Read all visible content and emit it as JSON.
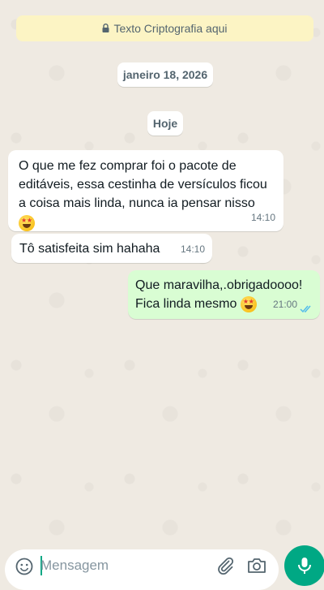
{
  "encryption_banner": {
    "icon": "lock-icon",
    "text": "Texto Criptografia aqui"
  },
  "date_separator": "janeiro 18, 2026",
  "today_separator": "Hoje",
  "messages": [
    {
      "direction": "incoming",
      "text": "O que me fez comprar foi o pacote de editáveis, essa cestinha de versículos ficou a coisa mais linda, nunca ia pensar nisso",
      "emoji": "star-struck-emoji",
      "time": "14:10"
    },
    {
      "direction": "incoming",
      "text": "Tô satisfeita sim hahaha",
      "time": "14:10"
    },
    {
      "direction": "outgoing",
      "line1": "Que maravilha,.obrigadoooo!",
      "line2": "Fica linda mesmo",
      "emoji": "star-struck-emoji",
      "time": "21:00",
      "status": "read"
    }
  ],
  "composer": {
    "placeholder": "Mensagem",
    "icons": [
      "emoji-icon",
      "paperclip-icon",
      "camera-icon",
      "microphone-icon"
    ]
  },
  "colors": {
    "wallpaper": "#efeae2",
    "outgoing_bubble": "#d9fdd3",
    "incoming_bubble": "#ffffff",
    "encryption_banner": "#fcf4c4",
    "accent": "#00a884",
    "read_ticks": "#53bdeb"
  }
}
